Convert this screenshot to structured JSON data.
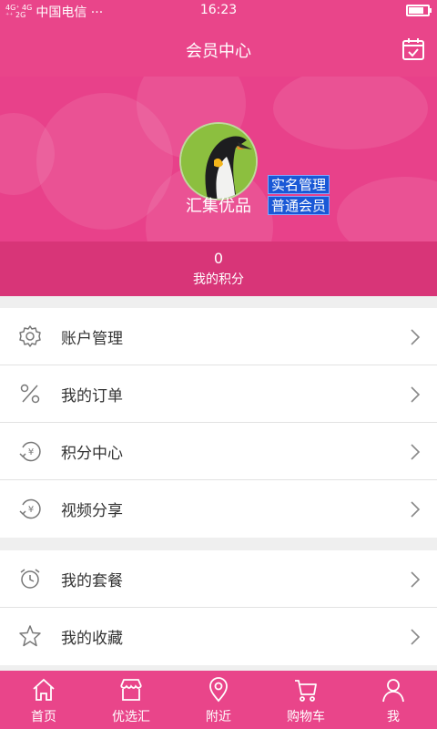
{
  "status": {
    "network_top": "4G⁺ 4G",
    "network_bottom": "⁺⁺ 2G",
    "carrier": "中国电信 ···",
    "time": "16:23"
  },
  "nav": {
    "title": "会员中心"
  },
  "profile": {
    "name": "汇集优品",
    "badges": [
      "实名管理",
      "普通会员"
    ],
    "points_value": "0",
    "points_label": "我的积分"
  },
  "menu_group_1": [
    {
      "label": "账户管理",
      "icon": "gear-icon"
    },
    {
      "label": "我的订单",
      "icon": "percent-icon"
    },
    {
      "label": "积分中心",
      "icon": "yen-exchange-icon"
    },
    {
      "label": "视频分享",
      "icon": "yen-exchange-icon"
    }
  ],
  "menu_group_2": [
    {
      "label": "我的套餐",
      "icon": "alarm-clock-icon"
    },
    {
      "label": "我的收藏",
      "icon": "star-icon"
    }
  ],
  "tabs": [
    {
      "label": "首页",
      "icon": "home-icon"
    },
    {
      "label": "优选汇",
      "icon": "shop-icon"
    },
    {
      "label": "附近",
      "icon": "location-pin-icon"
    },
    {
      "label": "购物车",
      "icon": "cart-icon"
    },
    {
      "label": "我",
      "icon": "user-icon"
    }
  ],
  "colors": {
    "brand": "#e9458a",
    "badge": "#1a58d6",
    "points_bar": "#d83578"
  }
}
